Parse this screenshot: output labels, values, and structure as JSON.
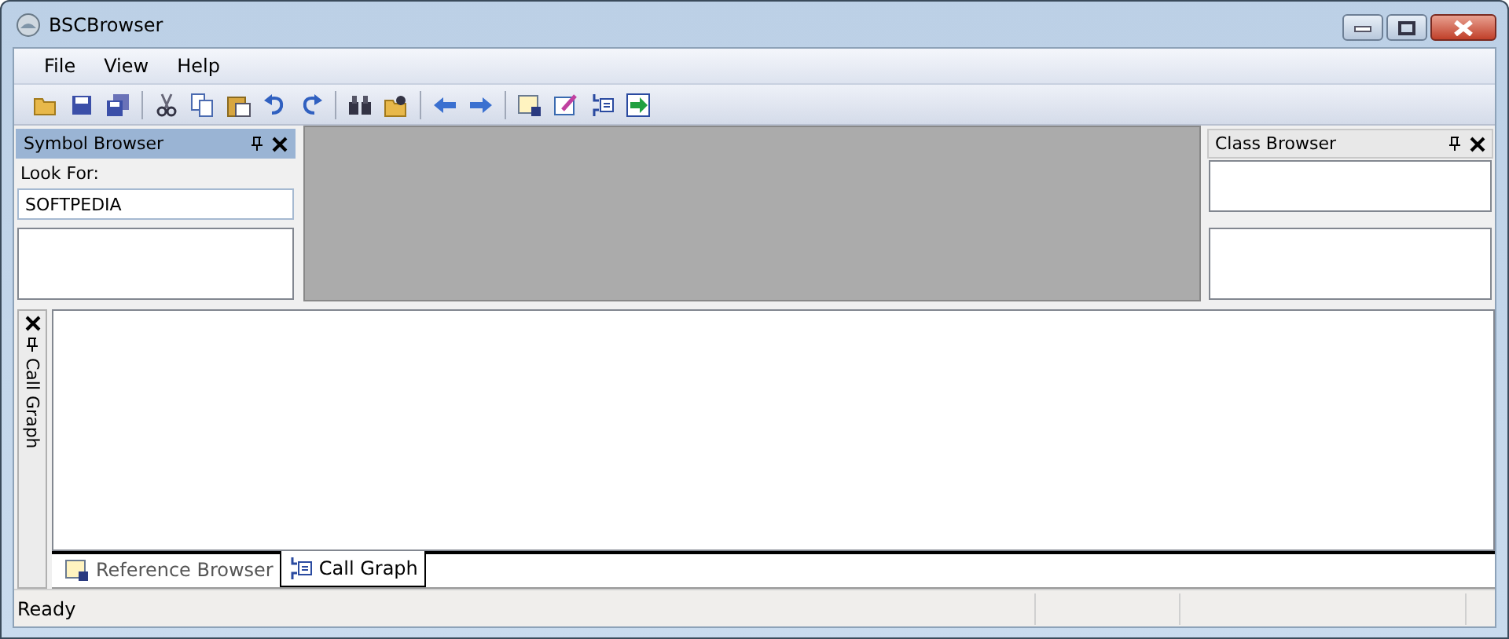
{
  "window": {
    "title": "BSCBrowser"
  },
  "menu": [
    "File",
    "View",
    "Help"
  ],
  "symbol_browser": {
    "title": "Symbol Browser",
    "label": "Look For:",
    "search_value": "SOFTPEDIA"
  },
  "class_browser": {
    "title": "Class Browser"
  },
  "call_graph_panel": {
    "title": "Call Graph"
  },
  "bottom_tabs": [
    {
      "label": "Reference Browser",
      "selected": false,
      "kind": "reference"
    },
    {
      "label": "Call Graph",
      "selected": true,
      "kind": "callgraph"
    }
  ],
  "status_bar": {
    "text": "Ready"
  }
}
